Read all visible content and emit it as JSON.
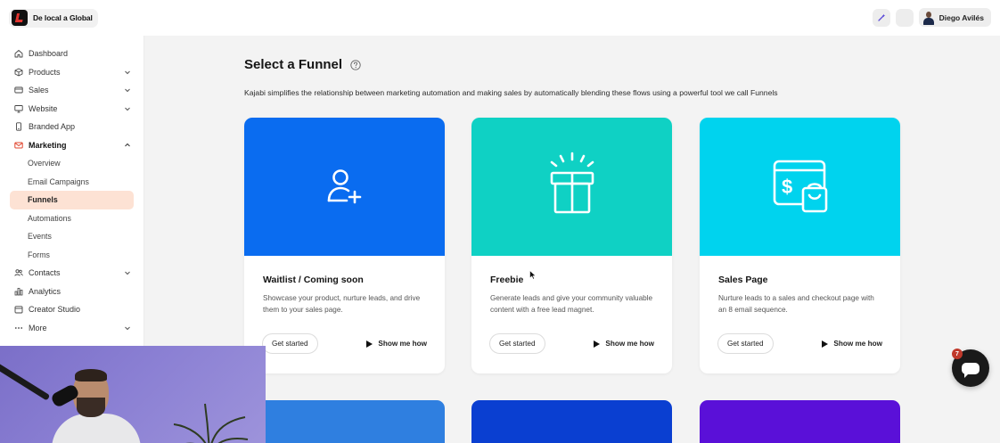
{
  "brand": {
    "name": "De local a Global"
  },
  "user": {
    "name": "Diego Avilés"
  },
  "sidebar": {
    "items": [
      {
        "label": "Dashboard"
      },
      {
        "label": "Products"
      },
      {
        "label": "Sales"
      },
      {
        "label": "Website"
      },
      {
        "label": "Branded App"
      },
      {
        "label": "Marketing"
      },
      {
        "label": "Contacts"
      },
      {
        "label": "Analytics"
      },
      {
        "label": "Creator Studio"
      },
      {
        "label": "More"
      }
    ],
    "marketing_sub": [
      {
        "label": "Overview"
      },
      {
        "label": "Email Campaigns"
      },
      {
        "label": "Funnels"
      },
      {
        "label": "Automations"
      },
      {
        "label": "Events"
      },
      {
        "label": "Forms"
      }
    ]
  },
  "main": {
    "title": "Select a Funnel",
    "description": "Kajabi simplifies the relationship between marketing automation and making sales by automatically blending these flows using a powerful tool we call Funnels",
    "cards": [
      {
        "title": "Waitlist / Coming soon",
        "text": "Showcase your product, nurture leads, and drive them to your sales page.",
        "primary": "Get started",
        "secondary": "Show me how",
        "color": "#0a6cf0",
        "icon": "user-plus-icon"
      },
      {
        "title": "Freebie",
        "text": "Generate leads and give your community valuable content with a free lead magnet.",
        "primary": "Get started",
        "secondary": "Show me how",
        "color": "#0fd1c4",
        "icon": "gift-icon"
      },
      {
        "title": "Sales Page",
        "text": "Nurture leads to a sales and checkout page with an 8 email sequence.",
        "primary": "Get started",
        "secondary": "Show me how",
        "color": "#00d3ee",
        "icon": "sales-page-icon"
      }
    ],
    "more_card_colors": [
      "#2f7fe0",
      "#0a3fd1",
      "#5a10d8"
    ]
  },
  "chat": {
    "badge": "7"
  }
}
